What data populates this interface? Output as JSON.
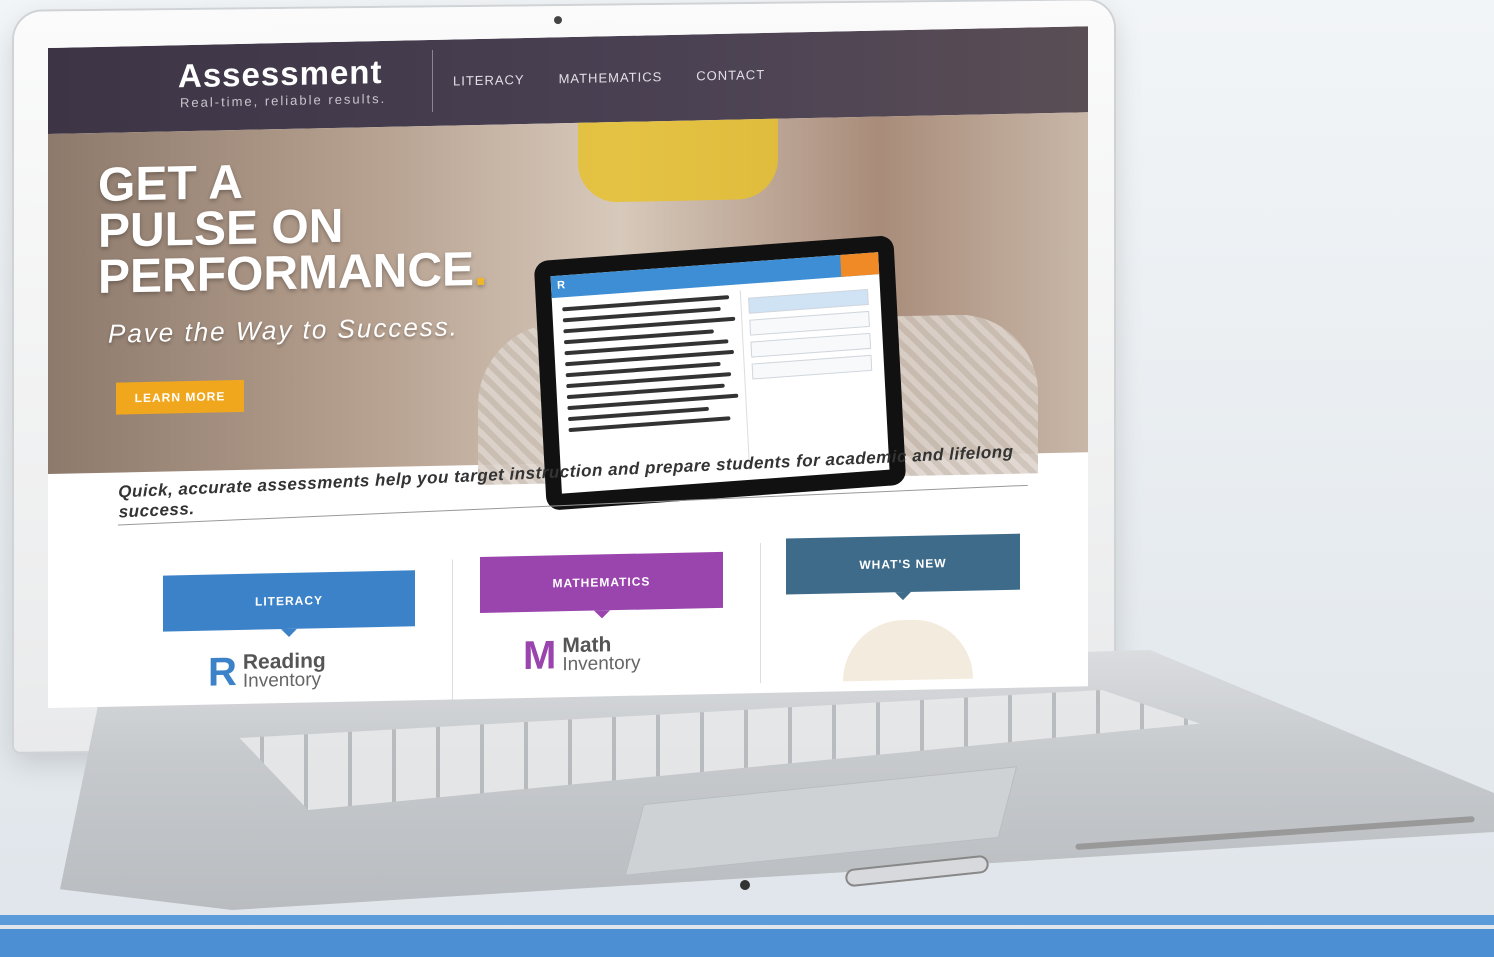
{
  "header": {
    "logo_title": "Assessment",
    "logo_tagline": "Real-time, reliable results.",
    "nav": [
      "LITERACY",
      "MATHEMATICS",
      "CONTACT"
    ]
  },
  "hero": {
    "headline_1": "GET A",
    "headline_2": "PULSE ON",
    "headline_3": "PERFORMANCE",
    "headline_dot": ".",
    "subhead": "Pave the Way to Success.",
    "button_label": "LEARN MORE"
  },
  "tagline": "Quick, accurate assessments help you target instruction and prepare students for academic and lifelong success.",
  "cards": {
    "literacy": "LITERACY",
    "mathematics": "MATHEMATICS",
    "whats_new": "WHAT'S NEW"
  },
  "products": {
    "reading": {
      "mark": "R",
      "name": "Reading",
      "sub": "Inventory"
    },
    "math": {
      "mark": "M",
      "name": "Math",
      "sub": "Inventory"
    }
  },
  "colors": {
    "header": "#3d3545",
    "accent": "#f0a71e",
    "literacy": "#3c82c8",
    "mathematics": "#9a44ad",
    "whats_new": "#3e6b8a"
  }
}
